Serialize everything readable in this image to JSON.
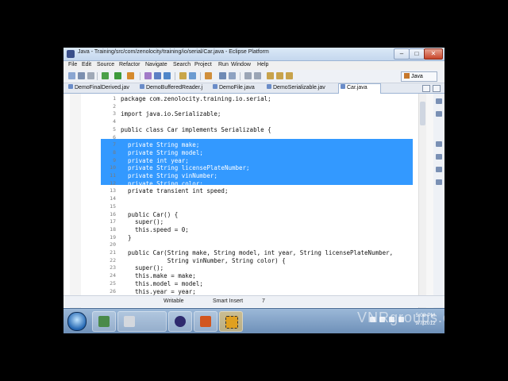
{
  "window": {
    "title": "Java - Training/src/com/zenolocity/training/io/serial/Car.java - Eclipse Platform",
    "minimize": "–",
    "maximize": "□",
    "close": "✕"
  },
  "menu": [
    "File",
    "Edit",
    "Source",
    "Refactor",
    "Navigate",
    "Search",
    "Project",
    "Run",
    "Window",
    "Help"
  ],
  "toolbar": {
    "perspective_label": "Java"
  },
  "tabs": [
    {
      "label": "DemoFinalDerived.jav",
      "active": false
    },
    {
      "label": "DemoBufferedReader.j",
      "active": false
    },
    {
      "label": "DemoFile.java",
      "active": false
    },
    {
      "label": "DemoSerializable.jav",
      "active": false
    },
    {
      "label": "Car.java",
      "active": true
    }
  ],
  "editor": {
    "lines": [
      {
        "n": "1",
        "text": "package com.zenolocity.training.io.serial;"
      },
      {
        "n": "2",
        "text": ""
      },
      {
        "n": "3",
        "text": "import java.io.Serializable;"
      },
      {
        "n": "4",
        "text": ""
      },
      {
        "n": "5",
        "text": "public class Car implements Serializable {"
      },
      {
        "n": "6",
        "text": ""
      },
      {
        "n": "7",
        "text": "  private String make;"
      },
      {
        "n": "8",
        "text": "  private String model;"
      },
      {
        "n": "9",
        "text": "  private int year;"
      },
      {
        "n": "10",
        "text": "  private String licensePlateNumber;"
      },
      {
        "n": "11",
        "text": "  private String vinNumber;"
      },
      {
        "n": "12",
        "text": "  private String color;"
      },
      {
        "n": "13",
        "text": "  private transient int speed;"
      },
      {
        "n": "14",
        "text": ""
      },
      {
        "n": "15",
        "text": ""
      },
      {
        "n": "16",
        "text": "  public Car() {"
      },
      {
        "n": "17",
        "text": "    super();"
      },
      {
        "n": "18",
        "text": "    this.speed = 0;"
      },
      {
        "n": "19",
        "text": "  }"
      },
      {
        "n": "20",
        "text": ""
      },
      {
        "n": "21",
        "text": "  public Car(String make, String model, int year, String licensePlateNumber,"
      },
      {
        "n": "22",
        "text": "             String vinNumber, String color) {"
      },
      {
        "n": "23",
        "text": "    super();"
      },
      {
        "n": "24",
        "text": "    this.make = make;"
      },
      {
        "n": "25",
        "text": "    this.model = model;"
      },
      {
        "n": "26",
        "text": "    this.year = year;"
      }
    ]
  },
  "status": {
    "mode": "Writable",
    "insert": "Smart Insert",
    "position": "7"
  },
  "taskbar": {
    "time": "5:08 PM",
    "date": "9/7/2012"
  },
  "watermark": "VNRgroups.com",
  "colors": {
    "selection": "#3399ff",
    "keyword": "#7f0055"
  }
}
